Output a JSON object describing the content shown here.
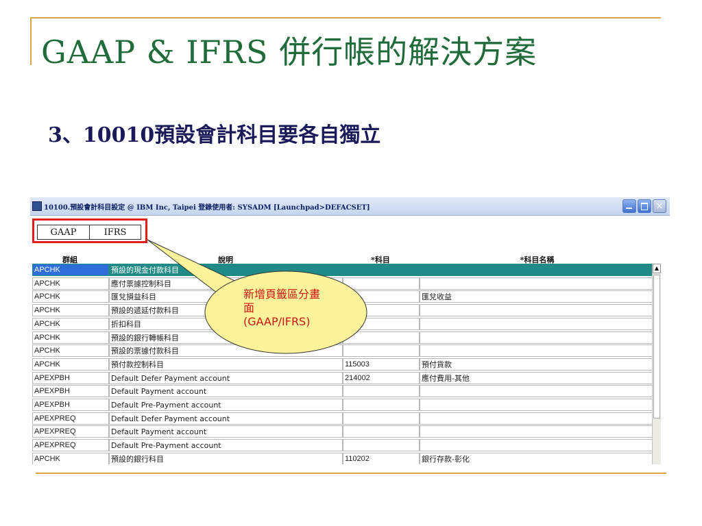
{
  "slide": {
    "title": "GAAP & IFRS 併行帳的解決方案",
    "subtitle": "3、10010預設會計科目要各自獨立"
  },
  "window": {
    "title": "10100.預設會計科目設定 @ IBM Inc, Taipei 登錄使用者: SYSADM [Launchpad>DEFACSET]",
    "close_glyph": "×"
  },
  "tabs": [
    {
      "label": "GAAP"
    },
    {
      "label": "IFRS"
    }
  ],
  "grid": {
    "headers": {
      "group": "群組",
      "desc": "說明",
      "acct": "*科目",
      "name": "*科目名稱"
    },
    "rows": [
      {
        "group": "APCHK",
        "desc": "預設的現金付款科目",
        "acct": "",
        "name": ""
      },
      {
        "group": "APCHK",
        "desc": "應付票據控制科目",
        "acct": "",
        "name": ""
      },
      {
        "group": "APCHK",
        "desc": "匯兌損益科目",
        "acct": "",
        "name": "匯兌收益"
      },
      {
        "group": "APCHK",
        "desc": "預設的遞延付款科目",
        "acct": "",
        "name": ""
      },
      {
        "group": "APCHK",
        "desc": "折扣科目",
        "acct": "",
        "name": ""
      },
      {
        "group": "APCHK",
        "desc": "預設的銀行轉帳科目",
        "acct": "",
        "name": ""
      },
      {
        "group": "APCHK",
        "desc": "預設的票據付款科目",
        "acct": "",
        "name": ""
      },
      {
        "group": "APCHK",
        "desc": "預付款控制科目",
        "acct": "115003",
        "name": "預付貨款"
      },
      {
        "group": "APEXPBH",
        "desc": "Default Defer Payment account",
        "acct": "214002",
        "name": "應付費用-其他"
      },
      {
        "group": "APEXPBH",
        "desc": "Default Payment account",
        "acct": "",
        "name": ""
      },
      {
        "group": "APEXPBH",
        "desc": "Default Pre-Payment account",
        "acct": "",
        "name": ""
      },
      {
        "group": "APEXPREQ",
        "desc": "Default Defer Payment account",
        "acct": "",
        "name": ""
      },
      {
        "group": "APEXPREQ",
        "desc": "Default Payment account",
        "acct": "",
        "name": ""
      },
      {
        "group": "APEXPREQ",
        "desc": "Default Pre-Payment account",
        "acct": "",
        "name": ""
      },
      {
        "group": "APCHK",
        "desc": "預設的銀行科目",
        "acct": "110202",
        "name": "銀行存款-彰化"
      }
    ],
    "selected_row": 0
  },
  "callout": {
    "line1": "新增頁籤區分畫",
    "line2": "面",
    "line3": "(GAAP/IFRS)",
    "fill_color": "#fdf39a",
    "text_color": "#cc1515"
  },
  "scrollbar": {
    "up_glyph": "▲"
  },
  "colors": {
    "title": "#1f6b3a",
    "accent_line": "#d9a44a",
    "selected_row": "#1f8a86",
    "highlight_border": "#e01e1e"
  }
}
